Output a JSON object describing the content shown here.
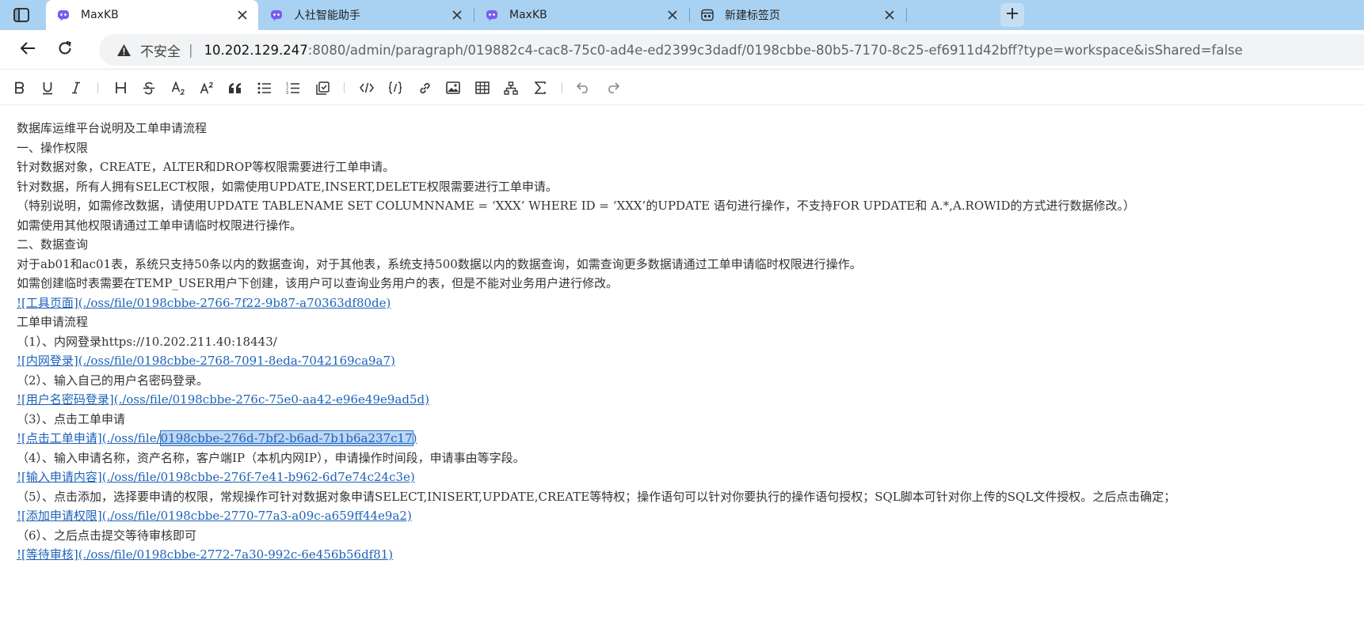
{
  "browser": {
    "tabs": [
      {
        "label": "MaxKB",
        "icon": "maxkb-icon",
        "active": true
      },
      {
        "label": "人社智能助手",
        "icon": "maxkb-icon",
        "active": false
      },
      {
        "label": "MaxKB",
        "icon": "maxkb-icon",
        "active": false
      },
      {
        "label": "新建标签页",
        "icon": "new-tab-page-icon",
        "active": false
      }
    ],
    "address": {
      "security_label": "不安全",
      "separator": "|",
      "host": "10.202.129.247",
      "rest": ":8080/admin/paragraph/019882c4-cac8-75c0-ad4e-ed2399c3dadf/0198cbbe-80b5-7170-8c25-ef6911d42bff?type=workspace&isShared=false"
    }
  },
  "toolbar": {
    "buttons": [
      "bold-icon",
      "underline-icon",
      "italic-icon",
      "heading-icon",
      "strikethrough-icon",
      "subscript-icon",
      "superscript-icon",
      "quote-icon",
      "bullet-list-icon",
      "ordered-list-icon",
      "task-list-icon",
      "code-icon",
      "code-block-icon",
      "link-icon",
      "image-icon",
      "table-icon",
      "flowchart-icon",
      "formula-icon",
      "undo-icon",
      "redo-icon"
    ]
  },
  "document": {
    "lines": [
      {
        "text": "数据库运维平台说明及工单申请流程"
      },
      {
        "text": "一、操作权限"
      },
      {
        "text": "针对数据对象，CREATE，ALTER和DROP等权限需要进行工单申请。"
      },
      {
        "text": "针对数据，所有人拥有SELECT权限，如需使用UPDATE,INSERT,DELETE权限需要进行工单申请。"
      },
      {
        "text": "（特别说明，如需修改数据，请使用UPDATE TABLENAME SET COLUMNNAME = ‘XXX’ WHERE ID = ‘XXX’的UPDATE 语句进行操作，不支持FOR UPDATE和 A.*,A.ROWID的方式进行数据修改。）"
      },
      {
        "text": "如需使用其他权限请通过工单申请临时权限进行操作。"
      },
      {
        "text": "二、数据查询"
      },
      {
        "text": "对于ab01和ac01表，系统只支持50条以内的数据查询，对于其他表，系统支持500数据以内的数据查询，如需查询更多数据请通过工单申请临时权限进行操作。"
      },
      {
        "text": "如需创建临时表需要在TEMP_USER用户下创建，该用户可以查询业务用户的表，但是不能对业务用户进行修改。"
      },
      {
        "link": "![工具页面](./oss/file/0198cbbe-2766-7f22-9b87-a70363df80de)"
      },
      {
        "text": "工单申请流程"
      },
      {
        "text": "（1）、内网登录https://10.202.211.40:18443/"
      },
      {
        "link": "![内网登录](./oss/file/0198cbbe-2768-7091-8eda-7042169ca9a7)"
      },
      {
        "text": "（2）、输入自己的用户名密码登录。"
      },
      {
        "link": "![用户名密码登录](./oss/file/0198cbbe-276c-75e0-aa42-e96e49e9ad5d)"
      },
      {
        "text": "（3）、点击工单申请"
      },
      {
        "link_pre": "![点击工单申请](./oss/file/",
        "link_sel": "0198cbbe-276d-7bf2-b6ad-7b1b6a237c17",
        "link_post": ")"
      },
      {
        "text": "（4）、输入申请名称，资产名称，客户端IP（本机内网IP），申请操作时间段，申请事由等字段。"
      },
      {
        "link": "![输入申请内容](./oss/file/0198cbbe-276f-7e41-b962-6d7e74c24c3e)"
      },
      {
        "text": "（5）、点击添加，选择要申请的权限，常规操作可针对数据对象申请SELECT,INISERT,UPDATE,CREATE等特权；操作语句可以针对你要执行的操作语句授权；SQL脚本可针对你上传的SQL文件授权。之后点击确定；"
      },
      {
        "link": "![添加申请权限](./oss/file/0198cbbe-2770-77a3-a09c-a659ff44e9a2)"
      },
      {
        "text": "（6）、之后点击提交等待审核即可"
      },
      {
        "link": "![等待审核](./oss/file/0198cbbe-2772-7a30-992c-6e456b56df81)"
      }
    ]
  },
  "colors": {
    "tabstrip": "#a9d2f2",
    "link": "#1d63b8",
    "selection": "#bcd6f5"
  }
}
